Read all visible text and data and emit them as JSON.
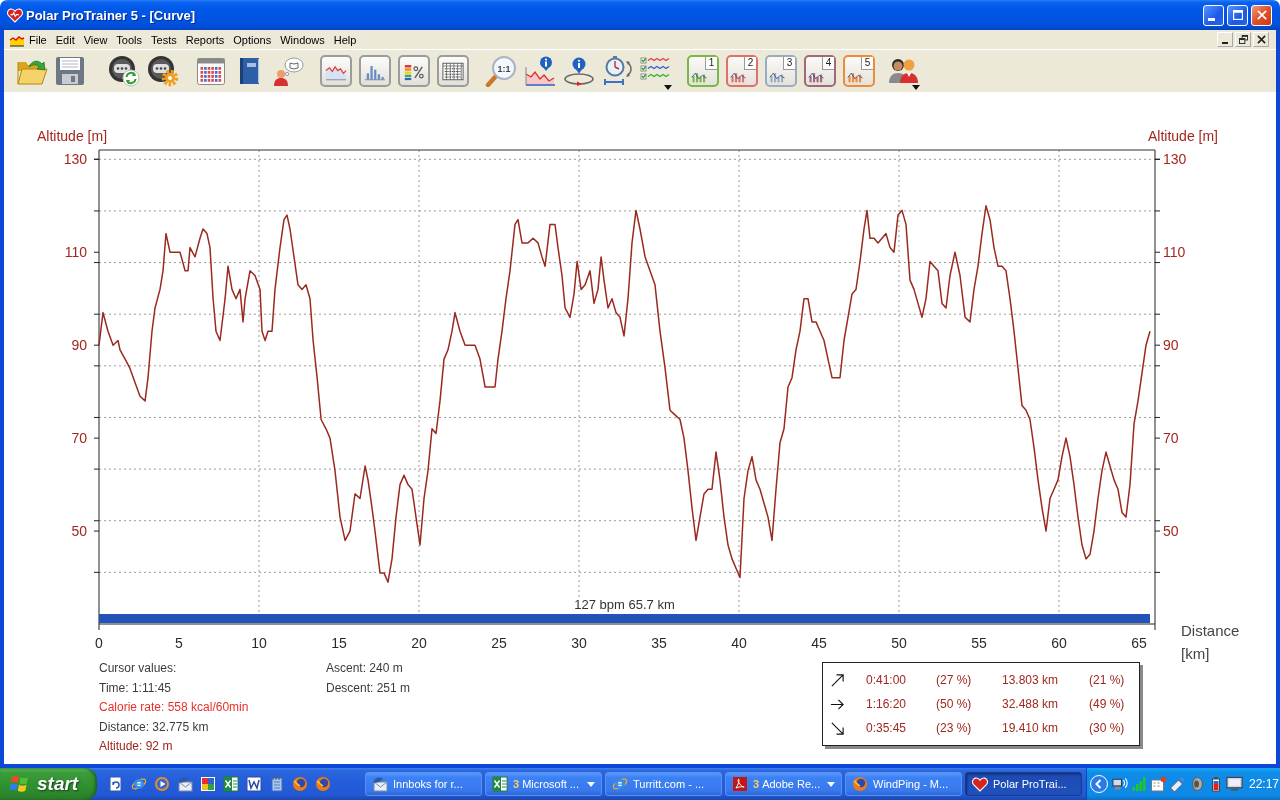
{
  "window": {
    "title": "Polar ProTrainer 5 - [Curve]"
  },
  "menu": [
    "File",
    "Edit",
    "View",
    "Tools",
    "Tests",
    "Reports",
    "Options",
    "Windows",
    "Help"
  ],
  "toolbar": {
    "zoom_label": "1:1",
    "presets": [
      {
        "label": "1",
        "color": "#7ab648"
      },
      {
        "label": "2",
        "color": "#e0706a"
      },
      {
        "label": "3",
        "color": "#9aacc4"
      },
      {
        "label": "4",
        "color": "#a06878"
      },
      {
        "label": "5",
        "color": "#ee8a3a"
      }
    ]
  },
  "chart": {
    "left_tick_labels": [
      "130",
      "110",
      "90",
      "70",
      "50"
    ],
    "right_axis": {
      "label": "Altitude [m]",
      "tick_labels": [
        "130",
        "110",
        "90",
        "70",
        "50"
      ]
    },
    "selection_label": "127 bpm 65.7 km",
    "chart_data": {
      "type": "line",
      "xlabel": "Distance [km]",
      "ylabel": "Altitude [m]",
      "grid": true,
      "x": [
        0,
        0.25,
        0.56,
        0.88,
        1.19,
        1.31,
        1.63,
        1.94,
        2.25,
        2.56,
        2.88,
        3.06,
        3.31,
        3.5,
        3.81,
        4.0,
        4.19,
        4.44,
        4.75,
        5.06,
        5.38,
        5.56,
        5.69,
        6.0,
        6.31,
        6.5,
        6.75,
        6.94,
        7.13,
        7.31,
        7.56,
        7.88,
        8.06,
        8.31,
        8.56,
        8.81,
        9.0,
        9.13,
        9.44,
        9.75,
        10.06,
        10.19,
        10.38,
        10.56,
        10.81,
        11.0,
        11.31,
        11.56,
        11.75,
        11.94,
        12.19,
        12.44,
        12.69,
        12.94,
        13.19,
        13.38,
        13.63,
        13.88,
        14.19,
        14.44,
        14.75,
        15.06,
        15.38,
        15.69,
        16.0,
        16.31,
        16.63,
        16.81,
        17.06,
        17.25,
        17.56,
        17.81,
        18.06,
        18.31,
        18.56,
        18.81,
        19.06,
        19.31,
        19.56,
        19.81,
        20.06,
        20.31,
        20.56,
        20.81,
        21.06,
        21.31,
        21.56,
        21.81,
        22.06,
        22.25,
        22.56,
        22.88,
        23.19,
        23.5,
        23.81,
        24.13,
        24.44,
        24.75,
        24.94,
        25.19,
        25.44,
        25.69,
        26.0,
        26.19,
        26.44,
        26.81,
        27.13,
        27.44,
        27.69,
        27.88,
        28.19,
        28.5,
        28.69,
        28.94,
        29.13,
        29.44,
        29.69,
        29.88,
        30.13,
        30.38,
        30.69,
        30.94,
        31.19,
        31.38,
        31.56,
        31.81,
        32.06,
        32.31,
        32.56,
        32.81,
        33.06,
        33.31,
        33.56,
        33.81,
        34.13,
        34.44,
        34.75,
        35.06,
        35.38,
        35.69,
        36.0,
        36.31,
        36.56,
        36.81,
        37.06,
        37.31,
        37.56,
        37.81,
        38.06,
        38.31,
        38.56,
        38.81,
        39.06,
        39.31,
        39.56,
        39.81,
        40.06,
        40.31,
        40.56,
        40.81,
        41.06,
        41.31,
        41.56,
        41.81,
        42.06,
        42.31,
        42.56,
        42.81,
        43.06,
        43.31,
        43.56,
        43.81,
        44.06,
        44.31,
        44.56,
        44.81,
        45.06,
        45.31,
        45.56,
        45.81,
        46.06,
        46.31,
        46.56,
        46.81,
        47.06,
        47.31,
        47.56,
        47.81,
        48.0,
        48.19,
        48.44,
        48.69,
        48.94,
        49.19,
        49.44,
        49.69,
        49.94,
        50.19,
        50.44,
        50.69,
        50.94,
        51.19,
        51.44,
        51.69,
        51.94,
        52.19,
        52.44,
        52.69,
        52.94,
        53.19,
        53.5,
        53.81,
        54.13,
        54.44,
        54.69,
        54.94,
        55.19,
        55.44,
        55.69,
        55.94,
        56.19,
        56.44,
        56.69,
        56.94,
        57.19,
        57.44,
        57.69,
        57.94,
        58.19,
        58.44,
        58.69,
        58.94,
        59.19,
        59.44,
        59.69,
        59.94,
        60.19,
        60.44,
        60.69,
        60.94,
        61.19,
        61.44,
        61.69,
        61.94,
        62.19,
        62.44,
        62.69,
        62.94,
        63.19,
        63.44,
        63.69,
        63.94,
        64.19,
        64.44,
        64.69,
        64.94,
        65.19,
        65.44,
        65.69
      ],
      "values": [
        90,
        97,
        93,
        90,
        91,
        89,
        87,
        85,
        82,
        79,
        78,
        83,
        93,
        98,
        102,
        106,
        114,
        110,
        110,
        110,
        106,
        106,
        111,
        109,
        113,
        115,
        114,
        111,
        100,
        93,
        91,
        100,
        107,
        102,
        100,
        102,
        95,
        100,
        106,
        105,
        102,
        93,
        91,
        93,
        93,
        102,
        111,
        117,
        118,
        115,
        109,
        103,
        102,
        103,
        100,
        91,
        83,
        74,
        72,
        70,
        63,
        53,
        48,
        50,
        58,
        57,
        64,
        61,
        55,
        50,
        41,
        41,
        39,
        44,
        53,
        60,
        62,
        60,
        59,
        53,
        47,
        57,
        63,
        72,
        71,
        78,
        87,
        89,
        93,
        97,
        93,
        90,
        90,
        90,
        87,
        81,
        81,
        81,
        87,
        93,
        100,
        106,
        116,
        117,
        112,
        112,
        113,
        112,
        109,
        107,
        116,
        116,
        111,
        105,
        98,
        96,
        101,
        108,
        102,
        103,
        106,
        99,
        102,
        109,
        104,
        98,
        100,
        97,
        96,
        92,
        100,
        112,
        119,
        115,
        109,
        106,
        103,
        93,
        85,
        76,
        75,
        74,
        70,
        63,
        55,
        48,
        53,
        58,
        59,
        59,
        67,
        61,
        53,
        47,
        44,
        42,
        40,
        57,
        63,
        66,
        61,
        59,
        56,
        53,
        48,
        59,
        69,
        72,
        81,
        83,
        89,
        93,
        100,
        100,
        95,
        95,
        93,
        91,
        87,
        83,
        83,
        83,
        91,
        96,
        101,
        102,
        108,
        115,
        119,
        113,
        113,
        112,
        113,
        114,
        111,
        110,
        118,
        119,
        116,
        104,
        102,
        99,
        96,
        100,
        108,
        107,
        106,
        99,
        98,
        105,
        110,
        105,
        96,
        95,
        102,
        107,
        114,
        120,
        117,
        111,
        107,
        107,
        106,
        100,
        93,
        85,
        77,
        76,
        74,
        68,
        61,
        55,
        50,
        57,
        59,
        61,
        66,
        70,
        66,
        60,
        53,
        47,
        44,
        45,
        50,
        57,
        63,
        67,
        64,
        61,
        59,
        54,
        53,
        60,
        73,
        78,
        84,
        90,
        93
      ],
      "xlim": [
        0,
        66
      ],
      "ylim": [
        30,
        132
      ],
      "xticks": [
        0,
        5,
        10,
        15,
        20,
        25,
        30,
        35,
        40,
        45,
        50,
        55,
        60,
        65
      ],
      "yticks": [
        50,
        70,
        90,
        110,
        130
      ]
    }
  },
  "cursor_values": [
    {
      "text": "Cursor values:",
      "color": "#3c3c3c"
    },
    {
      "text": "Time: 1:11:45",
      "color": "#3c3c3c"
    },
    {
      "text": "Calorie rate: 558 kcal/60min",
      "color": "#e8302a"
    },
    {
      "text": "Distance: 32.775 km",
      "color": "#3c3c3c"
    },
    {
      "text": "Altitude: 92 m",
      "color": "#a0281e"
    }
  ],
  "climb_stats": [
    "Ascent: 240 m",
    "Descent: 251 m"
  ],
  "summary_table": {
    "rows": [
      {
        "kind": "uphill",
        "time": "0:41:00",
        "time_share": "(27 %)",
        "distance": "13.803 km",
        "distance_share": "(21 %)"
      },
      {
        "kind": "level",
        "time": "1:16:20",
        "time_share": "(50 %)",
        "distance": "32.488 km",
        "distance_share": "(49 %)"
      },
      {
        "kind": "downhill",
        "time": "0:35:45",
        "time_share": "(23 %)",
        "distance": "19.410 km",
        "distance_share": "(30 %)"
      }
    ]
  },
  "taskbar": {
    "start": "start",
    "tasks": [
      {
        "kind": "mail",
        "label": "Innboks for r...",
        "grouped": false,
        "selected": false
      },
      {
        "kind": "spreadsheet",
        "count": "3",
        "label": "Microsoft ...",
        "grouped": true,
        "selected": false
      },
      {
        "kind": "browser",
        "label": "Turritt.com - ...",
        "grouped": false,
        "selected": false
      },
      {
        "kind": "pdf",
        "count": "3",
        "label": "Adobe Re...",
        "grouped": true,
        "selected": false
      },
      {
        "kind": "globe",
        "label": "WindPing - M...",
        "grouped": false,
        "selected": false
      },
      {
        "kind": "heart",
        "label": "Polar ProTrai...",
        "grouped": false,
        "selected": true
      }
    ],
    "clock": "22:17"
  }
}
